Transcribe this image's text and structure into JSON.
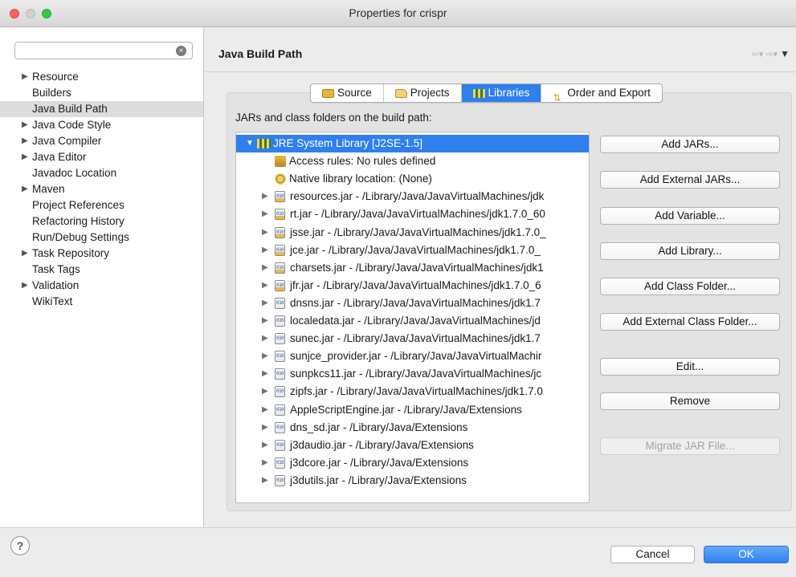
{
  "window": {
    "title": "Properties for crispr"
  },
  "sidebar": {
    "filter": {
      "value": "",
      "placeholder": ""
    },
    "items": [
      {
        "label": "Resource",
        "expandable": true
      },
      {
        "label": "Builders",
        "expandable": false
      },
      {
        "label": "Java Build Path",
        "expandable": false,
        "selected": true
      },
      {
        "label": "Java Code Style",
        "expandable": true
      },
      {
        "label": "Java Compiler",
        "expandable": true
      },
      {
        "label": "Java Editor",
        "expandable": true
      },
      {
        "label": "Javadoc Location",
        "expandable": false
      },
      {
        "label": "Maven",
        "expandable": true
      },
      {
        "label": "Project References",
        "expandable": false
      },
      {
        "label": "Refactoring History",
        "expandable": false
      },
      {
        "label": "Run/Debug Settings",
        "expandable": false
      },
      {
        "label": "Task Repository",
        "expandable": true
      },
      {
        "label": "Task Tags",
        "expandable": false
      },
      {
        "label": "Validation",
        "expandable": true
      },
      {
        "label": "WikiText",
        "expandable": false
      }
    ]
  },
  "header": {
    "title": "Java Build Path"
  },
  "tabs": [
    {
      "label": "Source",
      "icon": "source-folder-icon"
    },
    {
      "label": "Projects",
      "icon": "projects-folder-icon"
    },
    {
      "label": "Libraries",
      "icon": "libraries-icon",
      "active": true
    },
    {
      "label": "Order and Export",
      "icon": "order-export-icon"
    }
  ],
  "libraries": {
    "section_label": "JARs and class folders on the build path:",
    "tree": [
      {
        "label": "JRE System Library [J2SE-1.5]",
        "type": "library",
        "level": 0,
        "expanded": true,
        "selected": true
      },
      {
        "label": "Access rules: No rules defined",
        "type": "access-rules",
        "level": 1
      },
      {
        "label": "Native library location: (None)",
        "type": "native-location",
        "level": 1
      },
      {
        "label": "resources.jar - /Library/Java/JavaVirtualMachines/jdk",
        "type": "jar-access",
        "level": 1
      },
      {
        "label": "rt.jar - /Library/Java/JavaVirtualMachines/jdk1.7.0_60",
        "type": "jar-access",
        "level": 1
      },
      {
        "label": "jsse.jar - /Library/Java/JavaVirtualMachines/jdk1.7.0_",
        "type": "jar-access",
        "level": 1
      },
      {
        "label": "jce.jar - /Library/Java/JavaVirtualMachines/jdk1.7.0_",
        "type": "jar-access",
        "level": 1
      },
      {
        "label": "charsets.jar - /Library/Java/JavaVirtualMachines/jdk1",
        "type": "jar-access",
        "level": 1
      },
      {
        "label": "jfr.jar - /Library/Java/JavaVirtualMachines/jdk1.7.0_6",
        "type": "jar-access",
        "level": 1
      },
      {
        "label": "dnsns.jar - /Library/Java/JavaVirtualMachines/jdk1.7",
        "type": "jar",
        "level": 1
      },
      {
        "label": "localedata.jar - /Library/Java/JavaVirtualMachines/jd",
        "type": "jar",
        "level": 1
      },
      {
        "label": "sunec.jar - /Library/Java/JavaVirtualMachines/jdk1.7",
        "type": "jar",
        "level": 1
      },
      {
        "label": "sunjce_provider.jar - /Library/Java/JavaVirtualMachir",
        "type": "jar",
        "level": 1
      },
      {
        "label": "sunpkcs11.jar - /Library/Java/JavaVirtualMachines/jc",
        "type": "jar",
        "level": 1
      },
      {
        "label": "zipfs.jar - /Library/Java/JavaVirtualMachines/jdk1.7.0",
        "type": "jar",
        "level": 1
      },
      {
        "label": "AppleScriptEngine.jar - /Library/Java/Extensions",
        "type": "jar",
        "level": 1
      },
      {
        "label": "dns_sd.jar - /Library/Java/Extensions",
        "type": "jar",
        "level": 1
      },
      {
        "label": "j3daudio.jar - /Library/Java/Extensions",
        "type": "jar",
        "level": 1
      },
      {
        "label": "j3dcore.jar - /Library/Java/Extensions",
        "type": "jar",
        "level": 1
      },
      {
        "label": "j3dutils.jar - /Library/Java/Extensions",
        "type": "jar",
        "level": 1
      }
    ],
    "buttons": [
      {
        "label": "Add JARs...",
        "enabled": true
      },
      {
        "label": "Add External JARs...",
        "enabled": true
      },
      {
        "label": "Add Variable...",
        "enabled": true
      },
      {
        "label": "Add Library...",
        "enabled": true
      },
      {
        "label": "Add Class Folder...",
        "enabled": true
      },
      {
        "label": "Add External Class Folder...",
        "enabled": true
      },
      {
        "label": "Edit...",
        "enabled": true
      },
      {
        "label": "Remove",
        "enabled": true
      },
      {
        "label": "Migrate JAR File...",
        "enabled": false
      }
    ]
  },
  "footer": {
    "help_label": "?",
    "cancel_label": "Cancel",
    "ok_label": "OK"
  },
  "colors": {
    "accent": "#2f80ef",
    "selection_sidebar": "#dcdcdc"
  }
}
